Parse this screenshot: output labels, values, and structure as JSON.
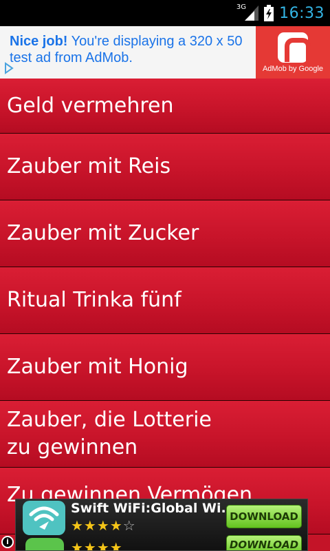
{
  "status_bar": {
    "network": "3G",
    "time": "16:33",
    "time_color": "#33b5e5"
  },
  "top_ad": {
    "headline": "Nice job!",
    "body": " You're displaying a 320 x 50 test ad from AdMob.",
    "brand_caption": "AdMob by Google",
    "brand_color": "#e53935",
    "adchoices_icon": "adchoices-icon"
  },
  "list": {
    "items": [
      {
        "label": "Geld vermehren"
      },
      {
        "label": "Zauber mit Reis"
      },
      {
        "label": "Zauber mit Zucker"
      },
      {
        "label": "Ritual Trinka fünf"
      },
      {
        "label": "Zauber mit Honig"
      },
      {
        "label": "Zauber, die Lotterie zu gewinnen"
      },
      {
        "label": "Zu gewinnen Vermögen"
      }
    ],
    "item_color": "#c8142a"
  },
  "bottom_ad": {
    "app_title": "Swift WiFi:Global Wi...",
    "rating_full": "★★★★",
    "rating_empty": "☆",
    "download_label": "DOWNLOAD",
    "download2_label": "DOWNLOAD",
    "rating2": "★★★★",
    "info_icon": "i"
  }
}
